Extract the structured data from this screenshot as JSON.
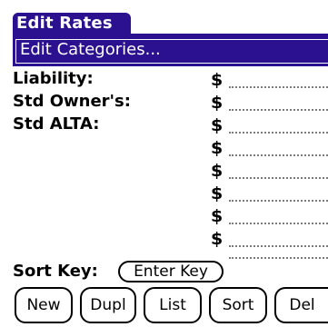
{
  "window": {
    "title": "Edit Rates",
    "title_color": "#2b108f"
  },
  "category_popup": {
    "label": "Edit Categories..."
  },
  "rates": {
    "currency_symbol": "$",
    "rows": [
      {
        "label": "Liability:",
        "value": ""
      },
      {
        "label": "Std Owner's:",
        "value": ""
      },
      {
        "label": "Std ALTA:",
        "value": ""
      },
      {
        "label": "",
        "value": ""
      },
      {
        "label": "",
        "value": ""
      },
      {
        "label": "",
        "value": ""
      },
      {
        "label": "",
        "value": ""
      },
      {
        "label": "",
        "value": ""
      },
      {
        "label": "",
        "value": ""
      }
    ]
  },
  "sort": {
    "label": "Sort Key:",
    "selector_value": "Enter Key"
  },
  "buttons": {
    "new": "New",
    "dupl": "Dupl",
    "list": "List",
    "sort": "Sort",
    "del": "Del"
  }
}
